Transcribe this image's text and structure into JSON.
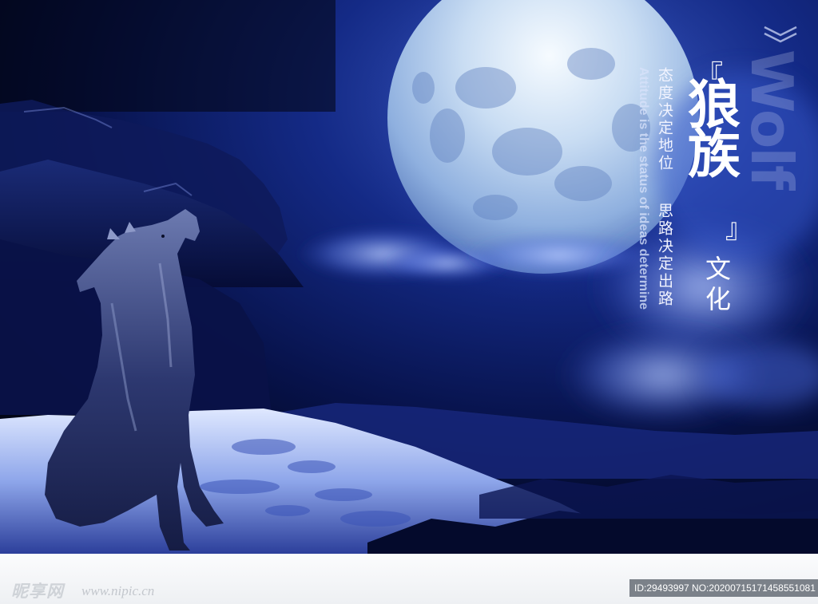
{
  "title": {
    "calligraphy": "狼族",
    "bracket_open": "『",
    "bracket_close": "』",
    "subtitle": "文化",
    "watermark_word": "Wolf"
  },
  "motto": {
    "cn_line_1": "态度决定地位",
    "cn_line_2": "思路决定出路",
    "en": "Attitude is the status of ideas determine"
  },
  "footer": {
    "logo_text": "昵享网",
    "url": "www.nipic.cn",
    "id_badge": "ID:29493997 NO:20200715171458551081"
  },
  "icons": {
    "chevron": "double-chevron-down-icon"
  },
  "colors": {
    "night_sky": "#050a2e",
    "moon": "#dbe8f7",
    "snow": "#c9d6f2",
    "text": "#ffffff",
    "badge": "#7b8189"
  }
}
